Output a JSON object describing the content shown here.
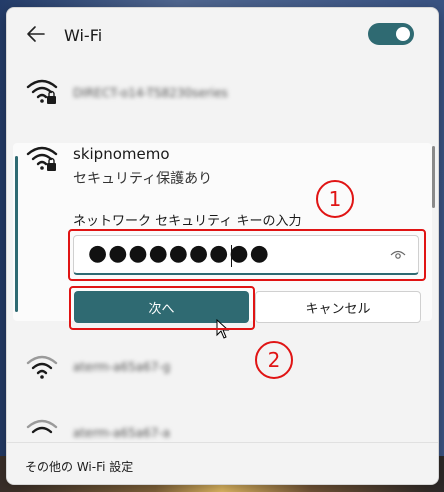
{
  "header": {
    "title": "Wi-Fi",
    "back_icon": "back-arrow-icon",
    "wifi_toggle_on": true
  },
  "networks": [
    {
      "ssid": "DIRECT-o14-TS8230series",
      "secured": true,
      "blurred": true
    },
    {
      "ssid": "skipnomemo",
      "secured": true,
      "status": "セキュリティ保護あり",
      "expanded": true
    },
    {
      "ssid": "aterm-a65a67-g",
      "secured": false,
      "blurred": true
    },
    {
      "ssid": "aterm-a65a67-a",
      "secured": false,
      "blurred": true
    }
  ],
  "connect_form": {
    "key_label": "ネットワーク セキュリティ キーの入力",
    "password_masked": "●●●●●●●●●",
    "next_label": "次へ",
    "cancel_label": "キャンセル"
  },
  "annotations": {
    "step1": "1",
    "step2": "2"
  },
  "footer": {
    "more_settings": "その他の Wi-Fi 設定"
  },
  "colors": {
    "accent": "#2f6a72",
    "highlight": "#e01414"
  }
}
